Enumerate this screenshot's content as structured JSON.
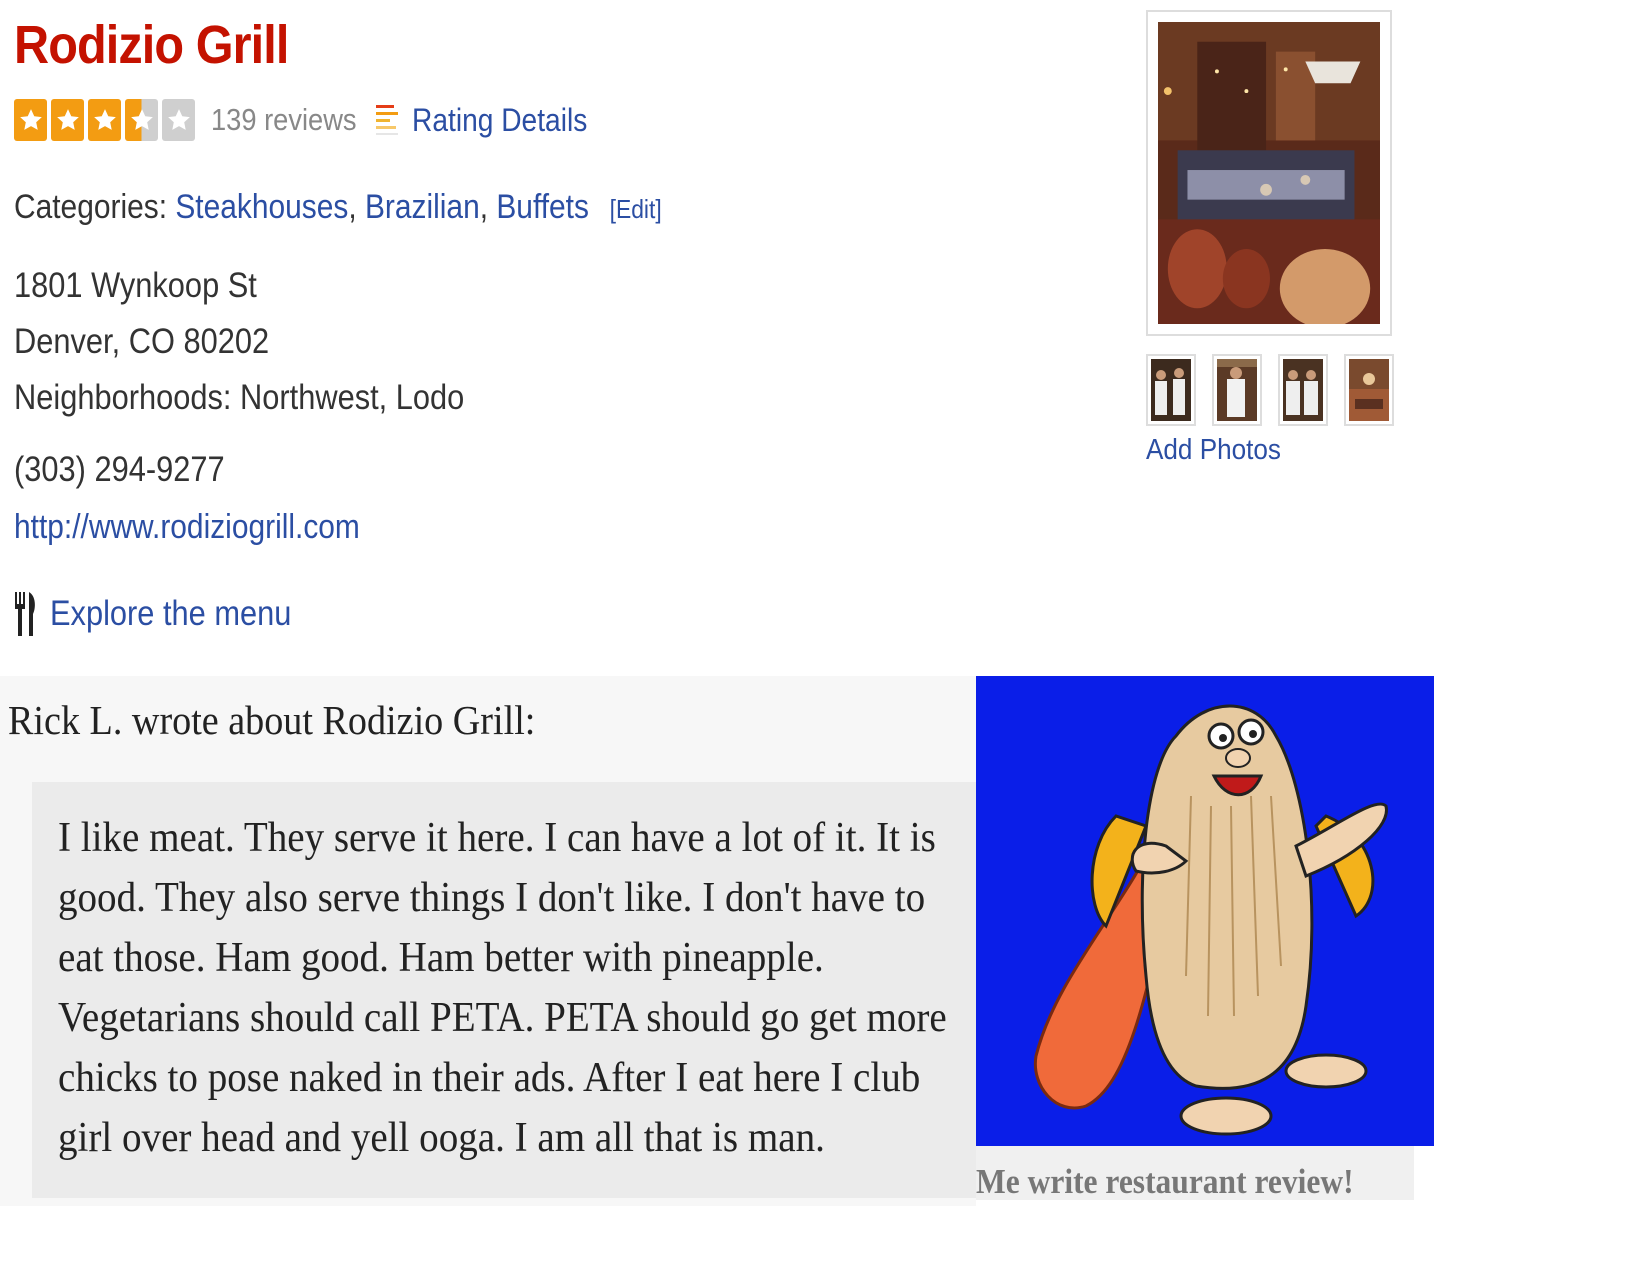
{
  "business": {
    "name": "Rodizio Grill",
    "rating": 3.5,
    "rating_max": 5,
    "review_count": "139 reviews",
    "rating_details_label": "Rating Details",
    "categories_label": "Categories:",
    "categories": [
      "Steakhouses",
      "Brazilian",
      "Buffets"
    ],
    "edit_label": "[Edit]",
    "address_line1": "1801 Wynkoop St",
    "address_line2": "Denver, CO 80202",
    "neighborhoods": "Neighborhoods: Northwest, Lodo",
    "phone": "(303) 294-9277",
    "website": "http://www.rodiziogrill.com",
    "menu_link": "Explore the menu",
    "colors": {
      "title": "#c41200",
      "link": "#2b4ea3",
      "star": "#f39c12"
    }
  },
  "photos": {
    "add_photos_label": "Add Photos",
    "thumbnail_count": 4
  },
  "review": {
    "heading": "Rick L. wrote about Rodizio Grill:",
    "lines": [
      "I like meat. They serve it here. I can have a lot of it. It is",
      "good. They also serve things I don't like. I don't have to",
      "eat those. Ham good. Ham better with pineapple.",
      "Vegetarians should call PETA. PETA should go get more",
      "chicks to pose naked in their ads. After I eat here I club",
      "girl over head and yell ooga. I am all that is man."
    ],
    "image_caption": "Me write restaurant review!",
    "image_background": "#0a1ee8"
  }
}
